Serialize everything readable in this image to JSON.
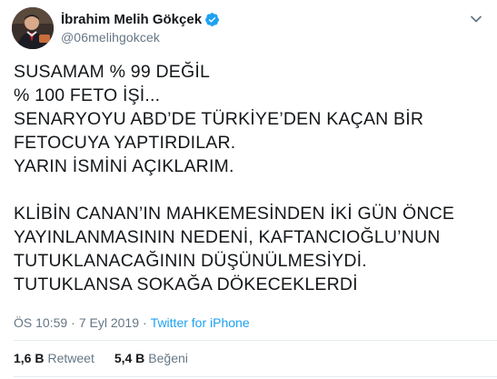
{
  "author": {
    "display_name": "İbrahim Melih Gökçek",
    "handle": "@06melihgokcek",
    "verified": true,
    "avatar_icon": "user-avatar"
  },
  "tweet": {
    "text": "SUSAMAM % 99 DEĞİL\n% 100 FETO İŞİ...\nSENARYOYU ABD’DE TÜRKİYE’DEN KAÇAN BİR FETOCUYA YAPTIRDILAR.\nYARIN İSMİNİ AÇIKLARIM.\n\nKLİBİN CANAN’IN MAHKEMESİNDEN İKİ GÜN ÖNCE YAYINLANMASININ NEDENİ, KAFTANCIOĞLU’NUN TUTUKLANACAĞININ DÜŞÜNÜLMESİYDİ.\nTUTUKLANSA SOKAĞA DÖKECEKLERDİ"
  },
  "meta": {
    "time": "ÖS 10:59",
    "separator": "·",
    "date": "7 Eyl 2019",
    "source": "Twitter for iPhone"
  },
  "stats": {
    "retweets_count": "1,6 B",
    "retweets_label": "Retweet",
    "likes_count": "5,4 B",
    "likes_label": "Beğeni"
  },
  "colors": {
    "text": "#14171a",
    "secondary": "#657786",
    "accent": "#1da1f2",
    "divider": "#e6ecf0"
  },
  "icons": {
    "verified": "verified-badge-icon",
    "menu": "chevron-down-icon"
  }
}
